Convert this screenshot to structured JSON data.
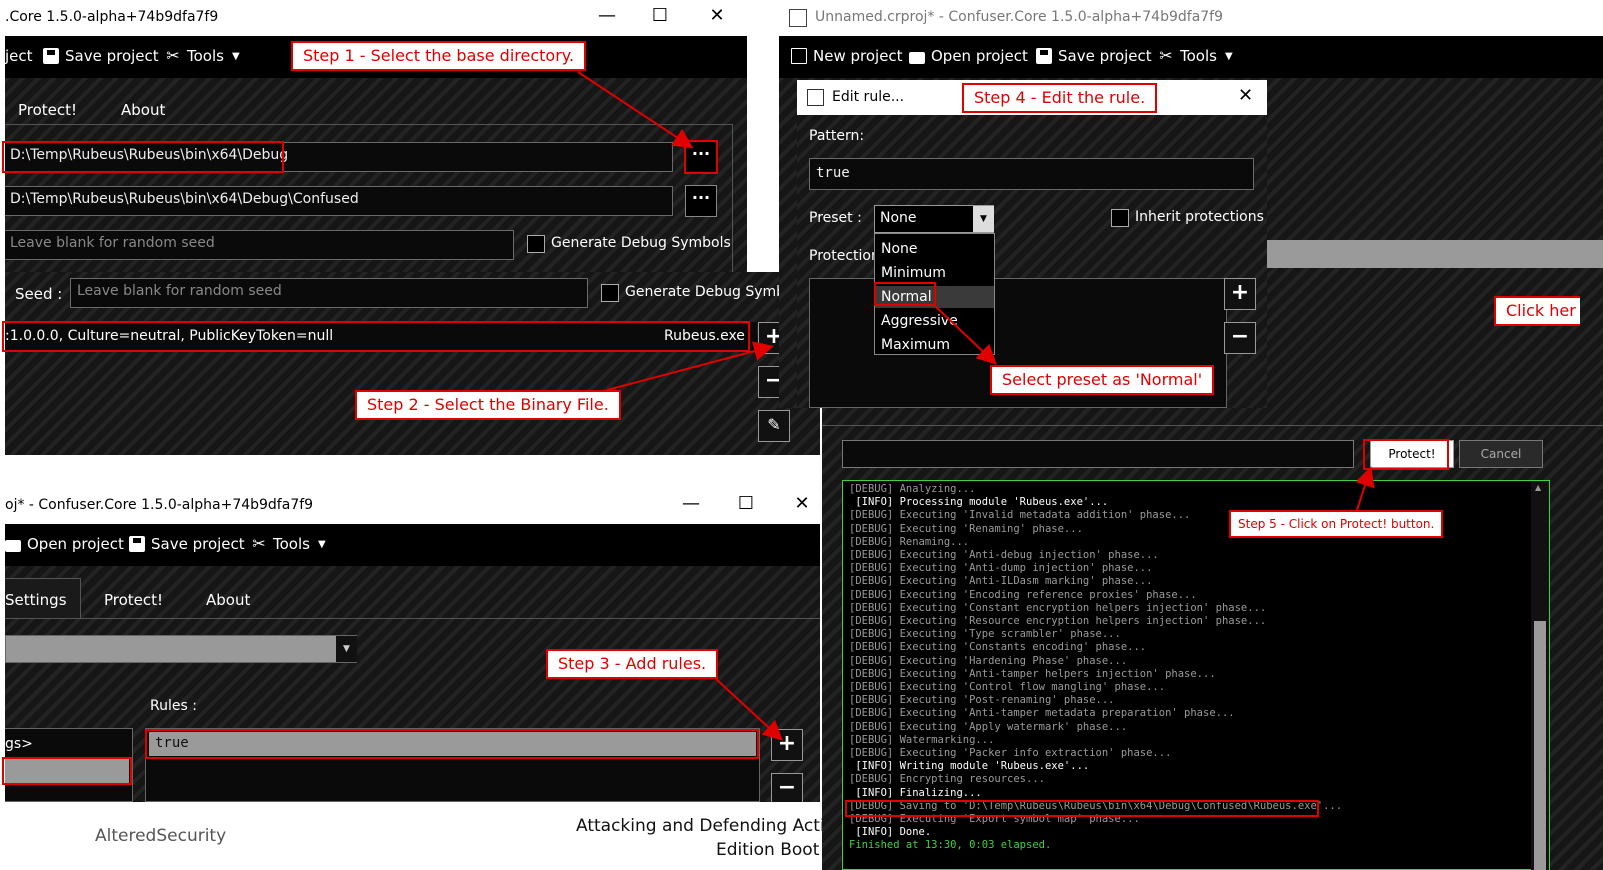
{
  "window1": {
    "title": ".Core 1.5.0-alpha+74b9dfa7f9",
    "toolbar": {
      "item1": "ject",
      "item2": "Save project",
      "item3": "Tools"
    },
    "tabs": [
      "Protect!",
      "About"
    ],
    "base_dir": "D:\\Temp\\Rubeus\\Rubeus\\bin\\x64\\Debug",
    "output_dir": "D:\\Temp\\Rubeus\\Rubeus\\bin\\x64\\Debug\\Confused",
    "seed_placeholder": "Leave blank for random seed",
    "debug_label": "Generate Debug Symbols",
    "browse_label": "···"
  },
  "window1b": {
    "seed_label": "Seed :",
    "seed_placeholder": "Leave blank for random seed",
    "debug_label": "Generate Debug Symbo",
    "module_info": ":1.0.0.0, Culture=neutral, PublicKeyToken=null",
    "module_file": "Rubeus.exe",
    "add": "+",
    "remove": "−"
  },
  "window2": {
    "title": "Unnamed.crproj* - Confuser.Core 1.5.0-alpha+74b9dfa7f9",
    "toolbar": {
      "new": "New project",
      "open": "Open project",
      "save": "Save project",
      "tools": "Tools"
    },
    "right_link": "Click her",
    "dialog": {
      "title": "Edit rule...",
      "pattern_label": "Pattern:",
      "pattern_value": "true",
      "preset_label": "Preset :",
      "preset_value": "None",
      "inherit_label": "Inherit protections",
      "protections_label": "Protection",
      "options": [
        "None",
        "Minimum",
        "Normal",
        "Aggressive",
        "Maximum"
      ],
      "add": "+",
      "remove": "−"
    }
  },
  "window3": {
    "title": "oj* - Confuser.Core 1.5.0-alpha+74b9dfa7f9",
    "toolbar": {
      "open": "Open project",
      "save": "Save project",
      "tools": "Tools"
    },
    "tabs": [
      "Settings",
      "Protect!",
      "About"
    ],
    "rules_label": "Rules :",
    "rule_value": "true",
    "left_item": "gs>",
    "add": "+",
    "remove": "−"
  },
  "window4": {
    "protect_button": "Protect!",
    "cancel_button": "Cancel",
    "log": [
      {
        "t": "[DEBUG] Analyzing...",
        "s": "d"
      },
      {
        "t": " [INFO] Processing module 'Rubeus.exe'...",
        "s": "i"
      },
      {
        "t": "[DEBUG] Executing 'Invalid metadata addition' phase...",
        "s": "d"
      },
      {
        "t": "[DEBUG] Executing 'Renaming' phase...",
        "s": "d"
      },
      {
        "t": "[DEBUG] Renaming...",
        "s": "d"
      },
      {
        "t": "[DEBUG] Executing 'Anti-debug injection' phase...",
        "s": "d"
      },
      {
        "t": "[DEBUG] Executing 'Anti-dump injection' phase...",
        "s": "d"
      },
      {
        "t": "[DEBUG] Executing 'Anti-ILDasm marking' phase...",
        "s": "d"
      },
      {
        "t": "[DEBUG] Executing 'Encoding reference proxies' phase...",
        "s": "d"
      },
      {
        "t": "[DEBUG] Executing 'Constant encryption helpers injection' phase...",
        "s": "d"
      },
      {
        "t": "[DEBUG] Executing 'Resource encryption helpers injection' phase...",
        "s": "d"
      },
      {
        "t": "[DEBUG] Executing 'Type scrambler' phase...",
        "s": "d"
      },
      {
        "t": "[DEBUG] Executing 'Constants encoding' phase...",
        "s": "d"
      },
      {
        "t": "[DEBUG] Executing 'Hardening Phase' phase...",
        "s": "d"
      },
      {
        "t": "[DEBUG] Executing 'Anti-tamper helpers injection' phase...",
        "s": "d"
      },
      {
        "t": "[DEBUG] Executing 'Control flow mangling' phase...",
        "s": "d"
      },
      {
        "t": "[DEBUG] Executing 'Post-renaming' phase...",
        "s": "d"
      },
      {
        "t": "[DEBUG] Executing 'Anti-tamper metadata preparation' phase...",
        "s": "d"
      },
      {
        "t": "[DEBUG] Executing 'Apply watermark' phase...",
        "s": "d"
      },
      {
        "t": "[DEBUG] Watermarking...",
        "s": "d"
      },
      {
        "t": "[DEBUG] Executing 'Packer info extraction' phase...",
        "s": "d"
      },
      {
        "t": " [INFO] Writing module 'Rubeus.exe'...",
        "s": "i"
      },
      {
        "t": "[DEBUG] Encrypting resources...",
        "s": "d"
      },
      {
        "t": " [INFO] Finalizing...",
        "s": "i"
      },
      {
        "t": "[DEBUG] Saving to 'D:\\Temp\\Rubeus\\Rubeus\\bin\\x64\\Debug\\Confused\\Rubeus.exe'...",
        "s": "d"
      },
      {
        "t": "[DEBUG] Executing 'Export symbol map' phase...",
        "s": "d"
      },
      {
        "t": " [INFO] Done.",
        "s": "i"
      },
      {
        "t": "Finished at 13:30, 0:03 elapsed.",
        "s": "g"
      }
    ]
  },
  "callouts": {
    "step1": "Step 1 - Select the base directory.",
    "step2": "Step 2 - Select the Binary File.",
    "step3": "Step 3 - Add rules.",
    "step4": "Step 4 - Edit the rule.",
    "step5": "Step 5 - Click on Protect! button.",
    "preset": "Select preset as 'Normal'"
  },
  "footer": {
    "left": "AlteredSecurity",
    "right": "Attacking and Defending Active",
    "right2": "Edition Boot"
  },
  "colors": {
    "annotation": "#e00000",
    "log_green": "#3fd13f"
  }
}
